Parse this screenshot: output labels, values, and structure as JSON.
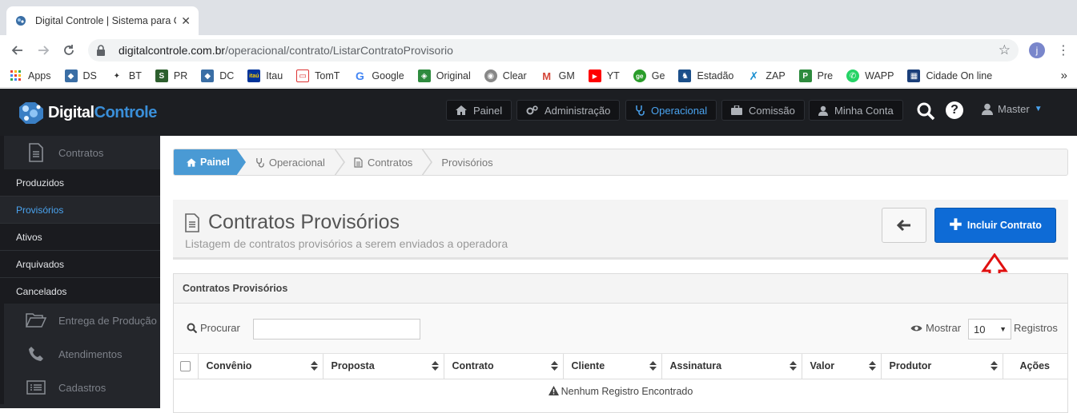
{
  "browser": {
    "tab_title": "Digital Controle | Sistema para Co",
    "url_host": "digitalcontrole.com.br",
    "url_path": "/operacional/contrato/ListarContratoProvisorio",
    "profile_initial": "j",
    "bookmarks": [
      "Apps",
      "DS",
      "BT",
      "PR",
      "DC",
      "Itau",
      "TomT",
      "Google",
      "Original",
      "Clear",
      "GM",
      "YT",
      "Ge",
      "Estadão",
      "ZAP",
      "Pre",
      "WAPP",
      "Cidade On line"
    ]
  },
  "header": {
    "logo_part1": "Digital",
    "logo_part2": "Controle",
    "nav": [
      "Painel",
      "Administração",
      "Operacional",
      "Comissão",
      "Minha Conta"
    ],
    "active_nav": "Operacional",
    "user": "Master"
  },
  "sidebar": {
    "sections": [
      "Contratos",
      "Entrega de Produção",
      "Atendimentos",
      "Cadastros"
    ],
    "items": [
      "Produzidos",
      "Provisórios",
      "Ativos",
      "Arquivados",
      "Cancelados"
    ],
    "active_item": "Provisórios"
  },
  "breadcrumb": [
    "Painel",
    "Operacional",
    "Contratos",
    "Provisórios"
  ],
  "page": {
    "title": "Contratos Provisórios",
    "subtitle": "Listagem de contratos provisórios a serem enviados a operadora",
    "include_button": "Incluir Contrato"
  },
  "panel": {
    "title": "Contratos Provisórios",
    "search_label": "Procurar",
    "search_value": "",
    "show_label": "Mostrar",
    "page_size": "10",
    "records_label": "Registros",
    "columns": [
      "Convênio",
      "Proposta",
      "Contrato",
      "Cliente",
      "Assinatura",
      "Valor",
      "Produtor",
      "Ações"
    ],
    "empty_message": "Nenhum Registro Encontrado"
  },
  "colors": {
    "accent": "#0e6bd6",
    "header_bg": "#1c1e22",
    "sidebar_bg": "#24262b",
    "active_link": "#4aa3ef",
    "annotation_red": "#e01010"
  }
}
